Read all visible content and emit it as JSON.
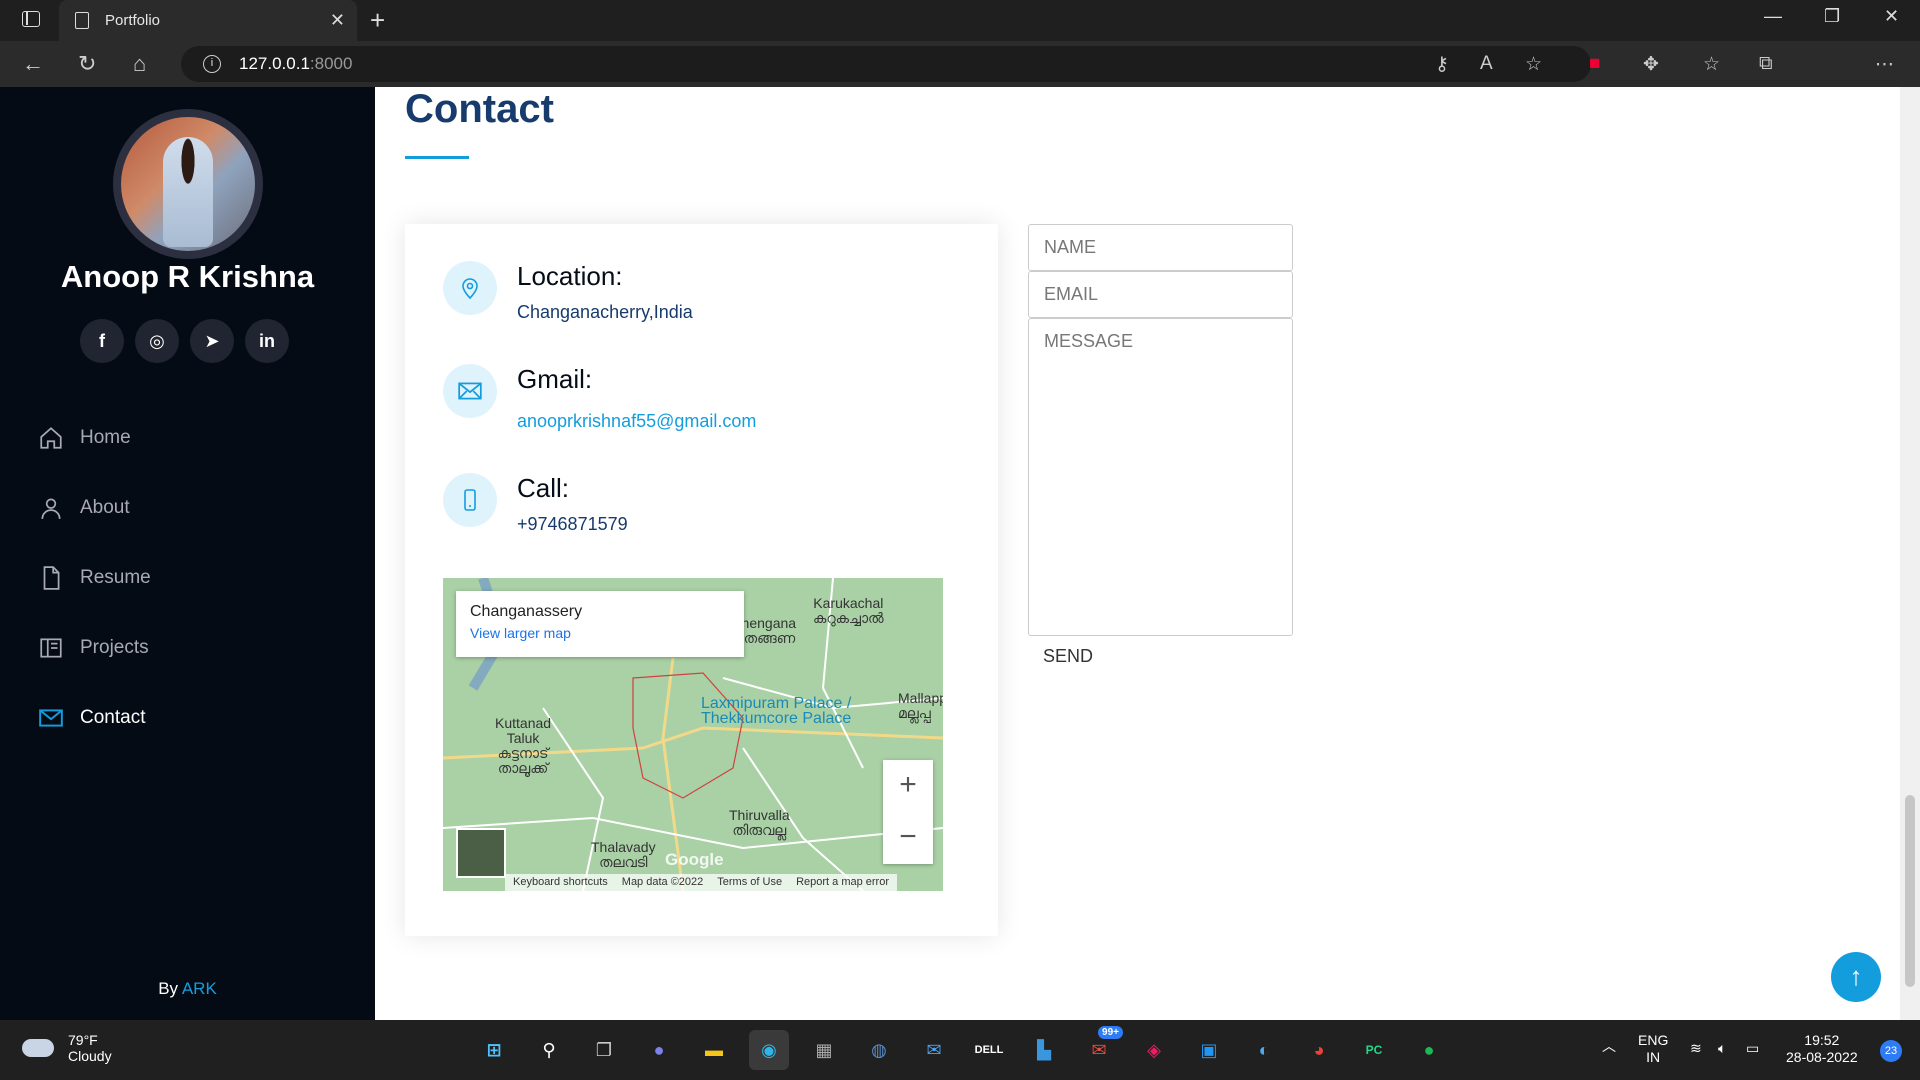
{
  "browser": {
    "tab_title": "Portfolio",
    "tab_close": "✕",
    "new_tab": "+",
    "url_host": "127.0.0.1",
    "url_port": ":8000",
    "window_controls": [
      "—",
      "❐",
      "✕"
    ]
  },
  "sidebar": {
    "name": "Anoop R Krishna",
    "socials": [
      "f",
      "◎",
      "➤",
      "in"
    ],
    "nav": [
      {
        "label": "Home",
        "icon": "home-icon"
      },
      {
        "label": "About",
        "icon": "user-icon"
      },
      {
        "label": "Resume",
        "icon": "file-icon"
      },
      {
        "label": "Projects",
        "icon": "book-icon"
      },
      {
        "label": "Contact",
        "icon": "envelope-icon",
        "active": true
      }
    ],
    "byline_prefix": "By ",
    "byline_name": "ARK"
  },
  "contact": {
    "title": "Contact",
    "location_label": "Location:",
    "location_value": "Changanacherry,India",
    "gmail_label": "Gmail:",
    "gmail_value": "anooprkrishnaf55@gmail.com",
    "call_label": "Call:",
    "call_value": "+9746871579"
  },
  "map": {
    "place": "Changanassery",
    "larger_link": "View larger map",
    "labels": [
      "Karukachal",
      "കറുകച്ചാൽ",
      "Thengana",
      "തെങ്ങണ",
      "Laxmipuram Palace /",
      "Thekkumcore Palace",
      "Kuttanad",
      "Taluk",
      "കുട്ടനാട്",
      "താലൂക്ക്",
      "Mallapp",
      "മല്ലപ്പ",
      "Thiruvalla",
      "തിരുവല്ല",
      "Thalavady",
      "തലവടി"
    ],
    "zoom_in": "+",
    "zoom_out": "−",
    "google": "Google",
    "footer": [
      "Keyboard shortcuts",
      "Map data ©2022",
      "Terms of Use",
      "Report a map error"
    ]
  },
  "form": {
    "name_placeholder": "NAME",
    "email_placeholder": "EMAIL",
    "message_placeholder": "MESSAGE",
    "send_label": "SEND"
  },
  "back_to_top": "↑",
  "taskbar": {
    "temp": "79°F",
    "condition": "Cloudy",
    "mail_badge": "99+",
    "lang": "ENG",
    "region": "IN",
    "time": "19:52",
    "date": "28-08-2022",
    "notif_count": "23"
  }
}
